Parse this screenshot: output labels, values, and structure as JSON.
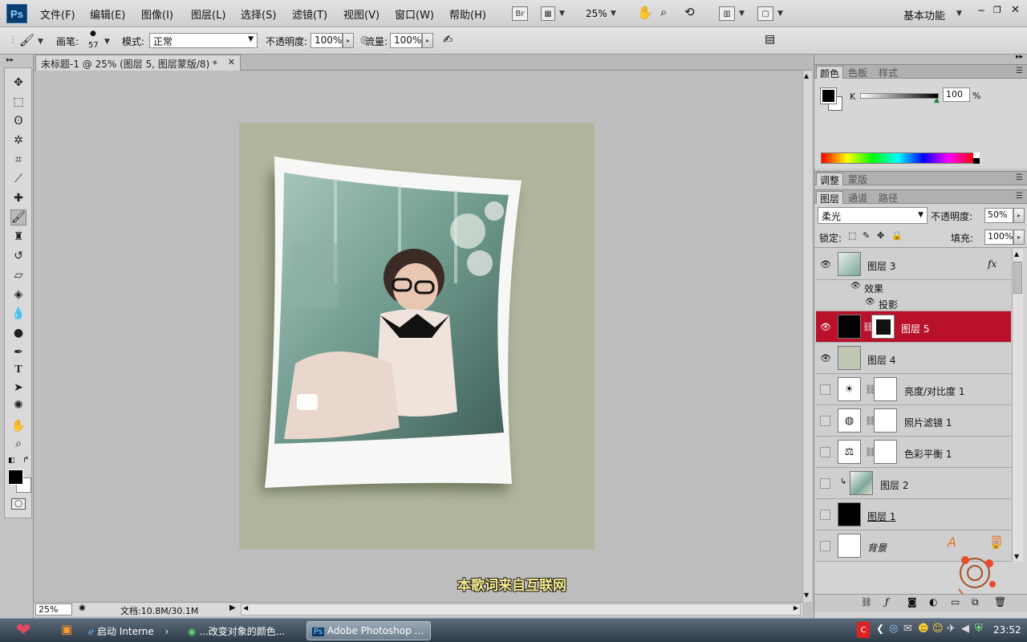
{
  "app": {
    "logo": "Ps"
  },
  "menu": [
    "文件(F)",
    "编辑(E)",
    "图像(I)",
    "图层(L)",
    "选择(S)",
    "滤镜(T)",
    "视图(V)",
    "窗口(W)",
    "帮助(H)"
  ],
  "menubar_extras": {
    "bridge": "Br",
    "zoom": "25%",
    "workspace": "基本功能"
  },
  "options": {
    "brush_label": "画笔:",
    "brush_size": "57",
    "mode_label": "模式:",
    "mode_value": "正常",
    "opacity_label": "不透明度:",
    "opacity_value": "100%",
    "flow_label": "流量:",
    "flow_value": "100%"
  },
  "document": {
    "tab_title": "未标题-1 @ 25% (图层 5, 图层蒙版/8) *",
    "watermark": "本歌词来自互联网"
  },
  "status": {
    "zoom": "25%",
    "doc_info": "文档:10.8M/30.1M"
  },
  "color_panel": {
    "tabs": [
      "颜色",
      "色板",
      "样式"
    ],
    "channel": "K",
    "value": "100",
    "unit": "%"
  },
  "adjust_panel": {
    "tabs": [
      "调整",
      "蒙版"
    ]
  },
  "layers_panel": {
    "tabs": [
      "图层",
      "通道",
      "路径"
    ],
    "blend_mode": "柔光",
    "opacity_label": "不透明度:",
    "opacity_value": "50%",
    "lock_label": "锁定:",
    "fill_label": "填充:",
    "fill_value": "100%",
    "effects_label": "效果",
    "drop_shadow_label": "投影",
    "fx": "fx",
    "layers": [
      "图层 3",
      "图层 5",
      "图层 4",
      "亮度/对比度 1",
      "照片滤镜 1",
      "色彩平衡 1",
      "图层 2",
      "图层 1",
      "背景"
    ]
  },
  "decor": {
    "letter_a": "A",
    "letter_jian": "简"
  },
  "taskbar": {
    "tasks": [
      "启动 Interne",
      "...改变对象的颜色...",
      "Adobe Photoshop ..."
    ],
    "clock": "23:52"
  }
}
